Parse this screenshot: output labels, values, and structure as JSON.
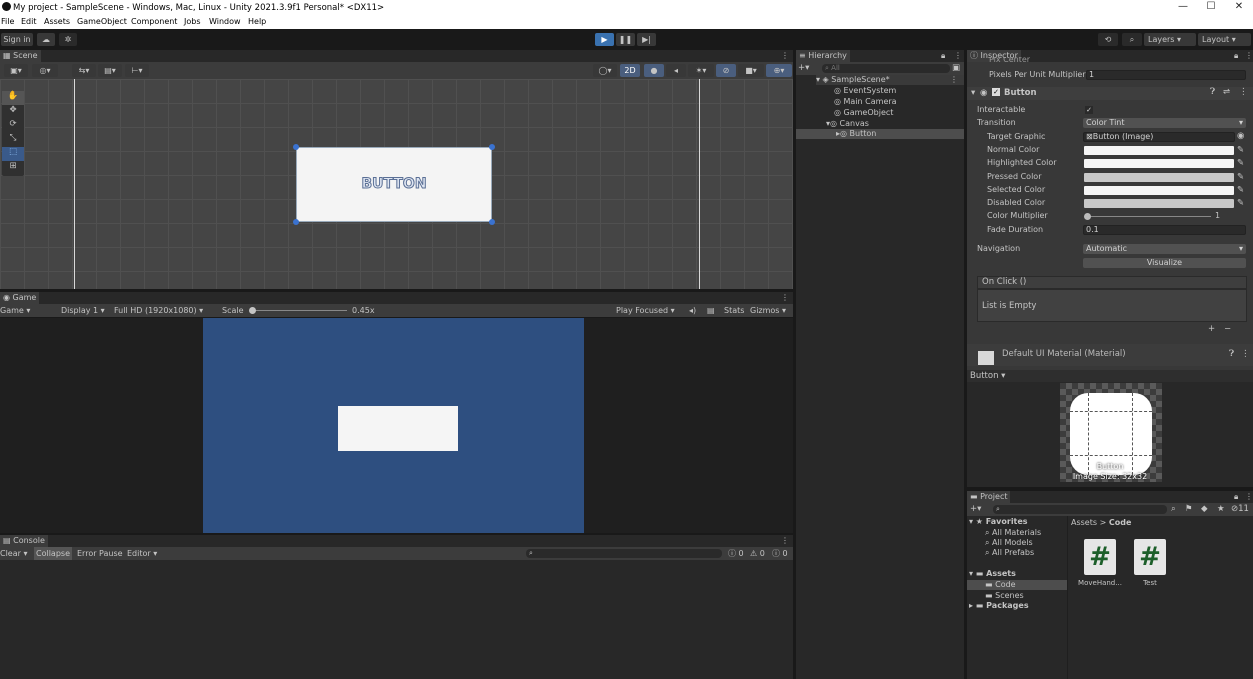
{
  "window": {
    "title": "My project - SampleScene - Windows, Mac, Linux - Unity 2021.3.9f1 Personal* <DX11>",
    "minimize": "—",
    "maximize": "☐",
    "close": "✕"
  },
  "menu": [
    "File",
    "Edit",
    "Assets",
    "GameObject",
    "Component",
    "Jobs",
    "Window",
    "Help"
  ],
  "toolbar": {
    "sign_in": "Sign in",
    "layers": "Layers",
    "layout": "Layout"
  },
  "scene": {
    "tab": "Scene",
    "button_text": "BUTTON",
    "mode_2d": "2D"
  },
  "game": {
    "tab": "Game",
    "view": "Game",
    "display": "Display 1",
    "resolution": "Full HD (1920x1080)",
    "scale_label": "Scale",
    "scale_value": "0.45x",
    "play_focused": "Play Focused",
    "stats": "Stats",
    "gizmos": "Gizmos"
  },
  "console": {
    "tab": "Console",
    "clear": "Clear",
    "collapse": "Collapse",
    "error_pause": "Error Pause",
    "editor": "Editor",
    "counts": [
      "0",
      "0",
      "0"
    ]
  },
  "hierarchy": {
    "tab": "Hierarchy",
    "search_placeholder": "All",
    "scene": "SampleScene*",
    "items": [
      "EventSystem",
      "Main Camera",
      "GameObject",
      "Canvas",
      "Button"
    ]
  },
  "inspector": {
    "tab": "Inspector",
    "clipped_label": "Pix Center",
    "ppu_label": "Pixels Per Unit Multiplier",
    "ppu_value": "1",
    "component": "Button",
    "fields": {
      "interactable": "Interactable",
      "transition": "Transition",
      "transition_value": "Color Tint",
      "target_graphic": "Target Graphic",
      "target_graphic_value": "Button (Image)",
      "normal": "Normal Color",
      "highlighted": "Highlighted Color",
      "pressed": "Pressed Color",
      "selected": "Selected Color",
      "disabled": "Disabled Color",
      "multiplier": "Color Multiplier",
      "multiplier_value": "1",
      "fade": "Fade Duration",
      "fade_value": "0.1",
      "navigation": "Navigation",
      "navigation_value": "Automatic",
      "visualize": "Visualize",
      "onclick": "On Click ()",
      "list_empty": "List is Empty"
    },
    "material": "Default UI Material (Material)",
    "preview_label": "Button",
    "preview_caption": "Button",
    "image_size": "Image Size: 32x32"
  },
  "project": {
    "tab": "Project",
    "favorites": "Favorites",
    "fav_items": [
      "All Materials",
      "All Models",
      "All Prefabs"
    ],
    "assets": "Assets",
    "asset_items": [
      "Code",
      "Scenes"
    ],
    "packages": "Packages",
    "breadcrumb_root": "Assets",
    "breadcrumb_sep": ">",
    "breadcrumb_leaf": "Code",
    "files": [
      "MoveHand...",
      "Test"
    ],
    "count": "11"
  },
  "colors": {
    "blue_bg": "#2e4f80",
    "accent": "#3a72b0"
  }
}
